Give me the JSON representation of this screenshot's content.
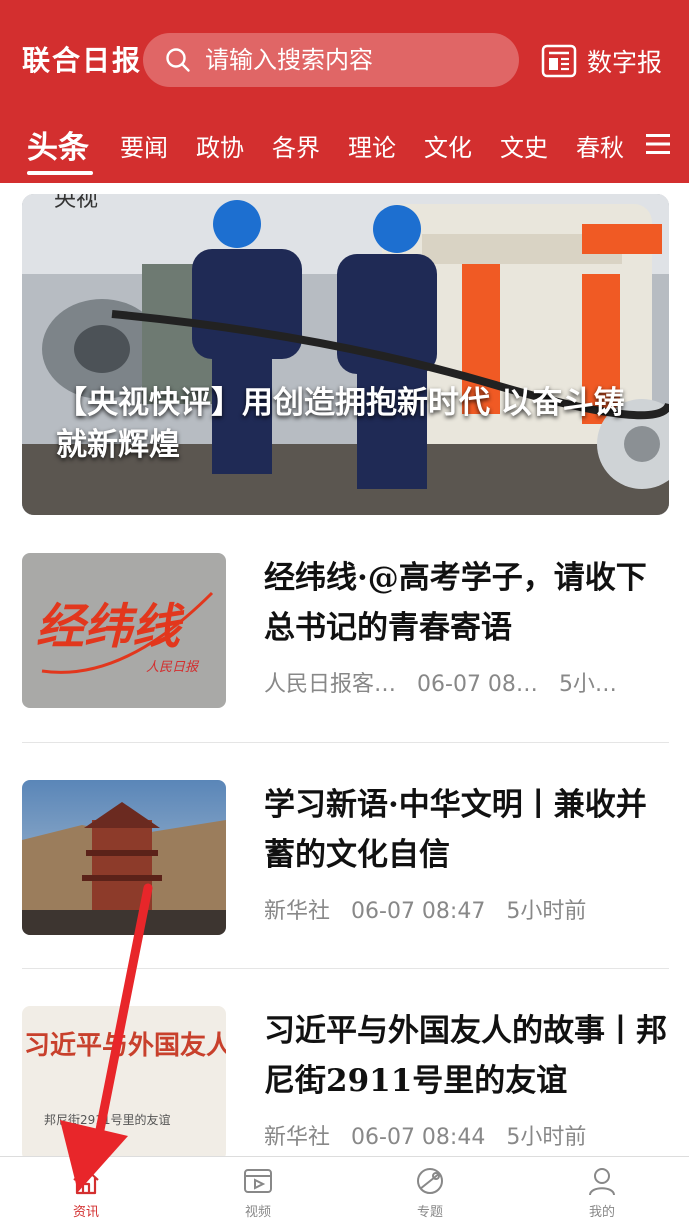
{
  "header": {
    "logo_text": "联合日报",
    "search_placeholder": "请输入搜索内容",
    "digital_label": "数字报",
    "brand_color": "#d32f2f"
  },
  "tabs": [
    {
      "label": "头条",
      "active": true
    },
    {
      "label": "要闻"
    },
    {
      "label": "政协"
    },
    {
      "label": "各界"
    },
    {
      "label": "理论"
    },
    {
      "label": "文化"
    },
    {
      "label": "文史"
    },
    {
      "label": "春秋"
    }
  ],
  "banner": {
    "caption": "【央视快评】用创造拥抱新时代 以奋斗铸就新辉煌",
    "corner_text": "央视",
    "slide_count": 5,
    "active_slide": 3
  },
  "news": [
    {
      "thumb_text": "经纬线",
      "thumb_sub": "人民日报",
      "title": "经纬线·@高考学子，请收下总书记的青春寄语",
      "source": "人民日报客…",
      "time": "06-07 08…",
      "ago": "5小…"
    },
    {
      "title": "学习新语·中华文明丨兼收并蓄的文化自信",
      "source": "新华社",
      "time": "06-07 08:47",
      "ago": "5小时前"
    },
    {
      "thumb_text": "习近平与外国友人的故事",
      "thumb_sub": "邦尼街2911号里的友谊",
      "title": "习近平与外国友人的故事丨邦尼街2911号里的友谊",
      "source": "新华社",
      "time": "06-07 08:44",
      "ago": "5小时前"
    }
  ],
  "bottom_nav": [
    {
      "label": "资讯",
      "icon": "home-icon",
      "active": true
    },
    {
      "label": "视频",
      "icon": "video-icon"
    },
    {
      "label": "专题",
      "icon": "topic-icon"
    },
    {
      "label": "我的",
      "icon": "user-icon"
    }
  ]
}
